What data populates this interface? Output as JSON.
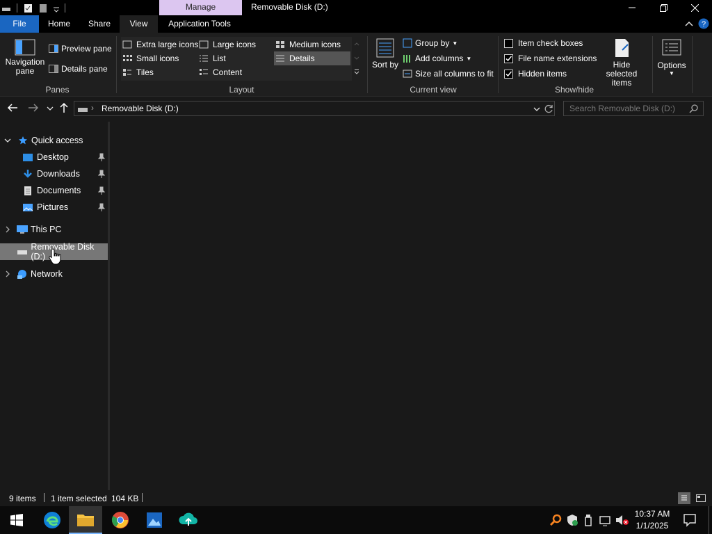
{
  "window": {
    "title": "Removable Disk (D:)",
    "context_tab_group": "Manage"
  },
  "ribbon_tabs": [
    "File",
    "Home",
    "Share",
    "View",
    "Application Tools"
  ],
  "ribbon": {
    "panes": {
      "group_label": "Panes",
      "navigation_pane": "Navigation pane",
      "preview_pane": "Preview pane",
      "details_pane": "Details pane"
    },
    "layout": {
      "group_label": "Layout",
      "options": [
        "Extra large icons",
        "Large icons",
        "Medium icons",
        "Small icons",
        "List",
        "Details",
        "Tiles",
        "Content"
      ],
      "selected": "Details"
    },
    "current_view": {
      "group_label": "Current view",
      "sort_by": "Sort by",
      "group_by": "Group by",
      "add_columns": "Add columns",
      "size_all_columns": "Size all columns to fit"
    },
    "show_hide": {
      "group_label": "Show/hide",
      "item_check_boxes": {
        "label": "Item check boxes",
        "checked": false
      },
      "file_name_extensions": {
        "label": "File name extensions",
        "checked": true
      },
      "hidden_items": {
        "label": "Hidden items",
        "checked": true
      },
      "hide_selected_items": "Hide selected items"
    },
    "options": "Options"
  },
  "address": {
    "path": "Removable Disk (D:)",
    "search_placeholder": "Search Removable Disk (D:)"
  },
  "nav_pane": {
    "quick_access": "Quick access",
    "pinned": [
      "Desktop",
      "Downloads",
      "Documents",
      "Pictures"
    ],
    "this_pc": "This PC",
    "removable": "Removable Disk (D:)",
    "network": "Network"
  },
  "status": {
    "items": "9 items",
    "selected": "1 item selected",
    "size": "104 KB"
  },
  "taskbar": {
    "time": "10:37 AM",
    "date": "1/1/2025",
    "apps": [
      "start-icon",
      "edge-icon",
      "file-explorer-icon",
      "chrome-icon",
      "photos-icon",
      "upload-app-icon"
    ]
  }
}
